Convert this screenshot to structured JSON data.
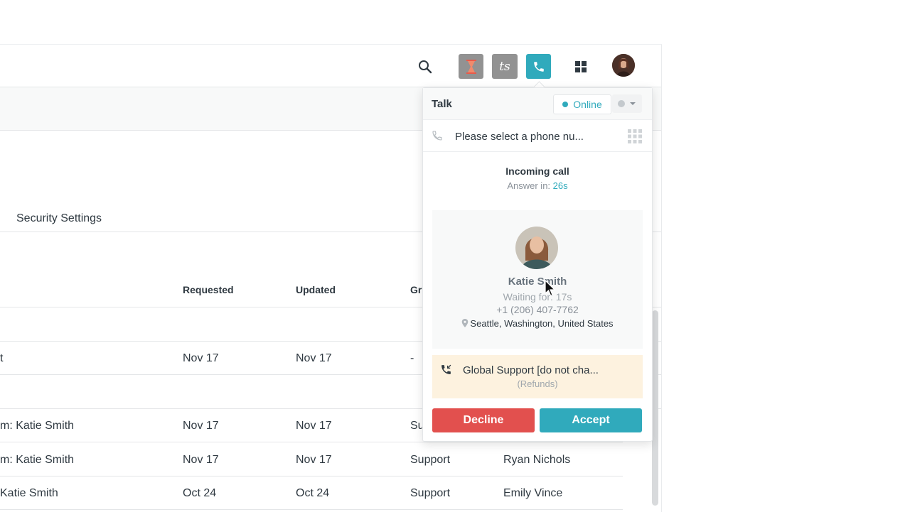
{
  "topbar": {
    "icons": [
      "search-icon",
      "hourglass-icon",
      "ts-app-icon",
      "phone-icon",
      "apps-grid-icon",
      "user-avatar"
    ],
    "ts_label": "ts"
  },
  "page": {
    "section_title": "Security Settings",
    "table": {
      "columns": [
        "Requested",
        "Updated",
        "Gr"
      ],
      "rows": [
        {
          "subject": "t",
          "requested": "Nov 17",
          "updated": "Nov 17",
          "group": "-",
          "assignee": ""
        },
        {
          "subject": "m: Katie Smith",
          "requested": "Nov 17",
          "updated": "Nov 17",
          "group": "Su",
          "assignee": ""
        },
        {
          "subject": "m: Katie Smith",
          "requested": "Nov 17",
          "updated": "Nov 17",
          "group": "Support",
          "assignee": "Ryan Nichols"
        },
        {
          "subject": "Katie Smith",
          "requested": "Oct 24",
          "updated": "Oct 24",
          "group": "Support",
          "assignee": "Emily Vince"
        }
      ]
    }
  },
  "talk": {
    "title": "Talk",
    "status": "Online",
    "phone_placeholder": "Please select a phone nu...",
    "incoming_title": "Incoming call",
    "answer_prefix": "Answer in:",
    "answer_time": "26s",
    "caller": {
      "name": "Katie Smith",
      "waiting": "Waiting for: 17s",
      "phone": "+1 (206) 407-7762",
      "location": "Seattle, Washington, United States"
    },
    "line": {
      "name": "Global Support [do not cha...",
      "sub": "(Refunds)"
    },
    "decline_label": "Decline",
    "accept_label": "Accept"
  },
  "colors": {
    "accent": "#30aabc",
    "decline": "#e2504e",
    "line_bg": "#fdf2df"
  }
}
